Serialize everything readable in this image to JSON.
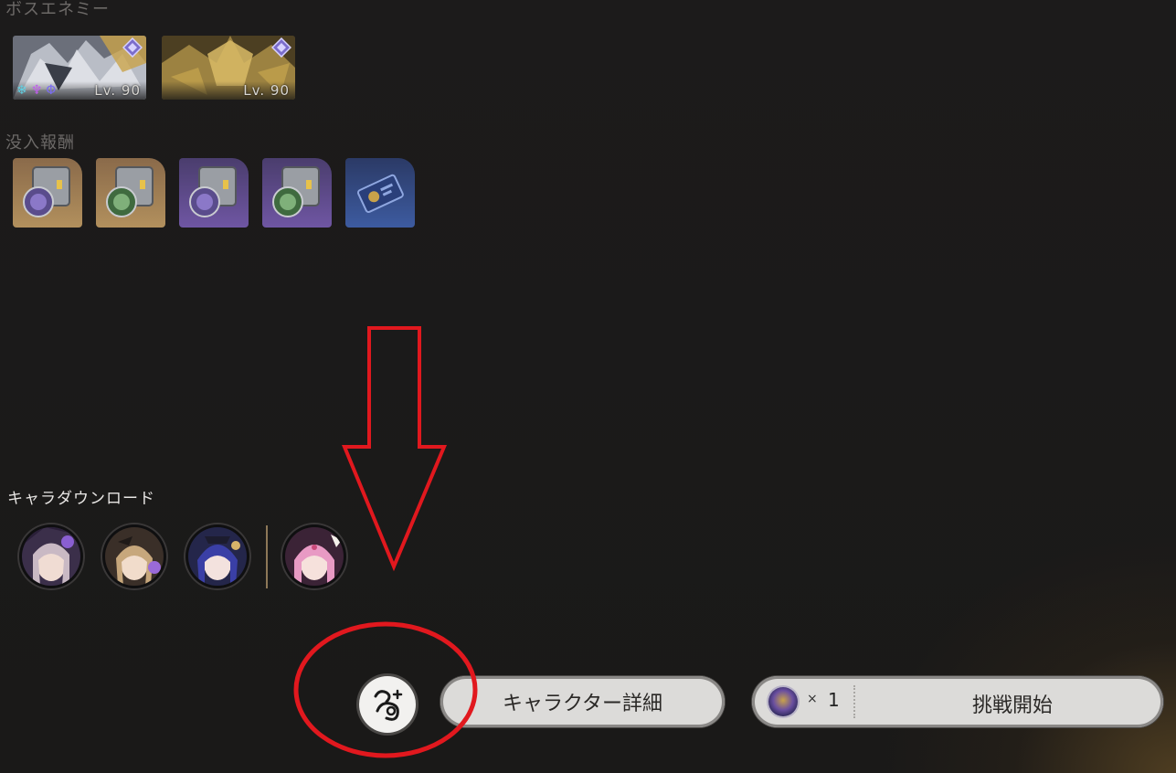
{
  "sections": {
    "boss_title": "ボスエネミー",
    "reward_title": "没入報酬",
    "download_title": "キャラダウンロード"
  },
  "bosses": [
    {
      "level": "Lv. 90",
      "elements": [
        "ice-icon",
        "imaginary-icon",
        "quantum-icon"
      ]
    },
    {
      "level": "Lv. 90",
      "elements": []
    }
  ],
  "rewards": [
    {
      "icon": "relic-gold-icon"
    },
    {
      "icon": "relic-gold-icon"
    },
    {
      "icon": "relic-purple-icon"
    },
    {
      "icon": "relic-purple-icon"
    },
    {
      "icon": "ticket-blue-icon"
    }
  ],
  "characters": [
    {
      "icon": "character-avatar-icon"
    },
    {
      "icon": "character-avatar-icon"
    },
    {
      "icon": "character-avatar-icon"
    },
    {
      "icon": "character-avatar-icon"
    }
  ],
  "buttons": {
    "details": "キャラクター詳細",
    "challenge": "挑戦開始",
    "cost_multiplier": "×",
    "cost_count": "1"
  },
  "colors": {
    "annotation": "#e1181e",
    "button_bg": "#dcdbd9"
  }
}
